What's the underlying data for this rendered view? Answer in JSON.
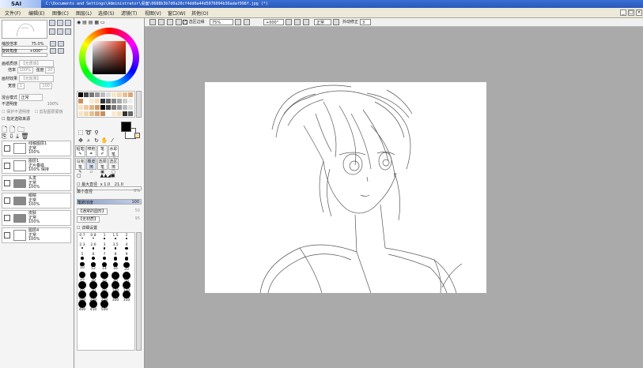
{
  "app": {
    "logo": "SAI",
    "title_path": "C:\\Documents and Settings\\Administrator\\桌面\\0688b3b7d0a20cf4dd0a44d5076094b36adaf998f.jpg (*)",
    "window_controls": [
      "_",
      "□",
      "×"
    ]
  },
  "menu": [
    "文件(F)",
    "编辑(E)",
    "图像(C)",
    "图层(L)",
    "选择(S)",
    "滤镜(T)",
    "视图(V)",
    "窗口(W)",
    "其他(O)"
  ],
  "options": {
    "anti_alias_label": "选区边缘",
    "zoom": "75%",
    "rotation": "+000°",
    "blend": "正常",
    "stabilizer_label": "抖动修正",
    "stabilizer_value": "3"
  },
  "navigator": {
    "zoom_label": "缩放倍率",
    "zoom_value": "75.0%",
    "angle_label": "旋转角度",
    "angle_value": "+000°"
  },
  "paper": {
    "texture_label": "画纸质感",
    "texture_value": "【无质感】",
    "scale_label": "倍率",
    "scale_value": "100%",
    "strength_label": "强度",
    "strength_value": "20",
    "effect_label": "画材效果",
    "effect_value": "【无效果】",
    "width_label": "宽度",
    "width_value": "1",
    "strength2_value": "100"
  },
  "layer_settings": {
    "blend_label": "混合模式",
    "blend_value": "正常",
    "opacity_label": "不透明度",
    "opacity_value": "100%",
    "protect_label": "保护不透明度",
    "clip_label": "剪贴图层蒙板",
    "select_source_label": "指定选取来源"
  },
  "layers": [
    {
      "name": "线稿图层1",
      "mode": "正常",
      "opacity": "100%",
      "kind": "layer"
    },
    {
      "name": "图层1",
      "mode": "正片叠底",
      "opacity": "100% 保持",
      "kind": "layer"
    },
    {
      "name": "头发",
      "mode": "正常",
      "opacity": "100%",
      "kind": "folder"
    },
    {
      "name": "眼睛",
      "mode": "正常",
      "opacity": "100%",
      "kind": "folder"
    },
    {
      "name": "皮肤",
      "mode": "正常",
      "opacity": "100%",
      "kind": "folder"
    },
    {
      "name": "图层4",
      "mode": "正常",
      "opacity": "100%",
      "kind": "layer"
    }
  ],
  "tools": {
    "names": [
      "铅笔",
      "喷枪",
      "笔",
      "水彩笔",
      "马克笔",
      "橡皮擦",
      "选择笔",
      "选区擦"
    ]
  },
  "brush": {
    "max_size_label": "最大直径",
    "max_size_mult": "x 1.0",
    "max_size_value": "21.0",
    "min_size_label": "最小直径",
    "min_size_value": "0%",
    "density_label": "笔刷浓度",
    "density_value": "100",
    "shape_value": "【通常的圆形】",
    "shape_strength": "50",
    "texture_value": "【无材质】",
    "texture_strength": "95",
    "detail_label": "详细设置"
  },
  "brush_sizes": [
    "0.7",
    "0.8",
    "1",
    "1.5",
    "2",
    "2.3",
    "2.6",
    "3",
    "3.5",
    "4",
    "5",
    "6",
    "7",
    "8",
    "9",
    "10",
    "12",
    "14",
    "16",
    "20",
    "25",
    "30",
    "35",
    "40",
    "50",
    "60",
    "70",
    "80",
    "100",
    "120",
    "160",
    "200",
    "250",
    "300",
    "350",
    "400",
    "450",
    "500"
  ],
  "colors": {
    "accent": "#3b6fd4",
    "workspace": "#aaaaaa",
    "main_color": "#000000"
  }
}
